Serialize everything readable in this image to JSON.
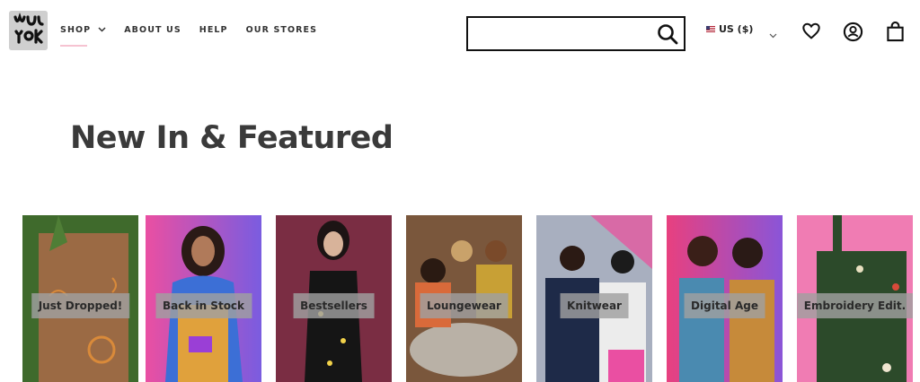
{
  "brand": {
    "logo_text": "Lucy & Yak"
  },
  "nav": {
    "items": [
      {
        "label": "SHOP",
        "has_dropdown": true
      },
      {
        "label": "ABOUT US"
      },
      {
        "label": "HELP"
      },
      {
        "label": "OUR STORES"
      }
    ]
  },
  "search": {
    "value": "",
    "placeholder": ""
  },
  "currency": {
    "label": "US ($)"
  },
  "icons": {
    "search": "search-icon",
    "currency_dropdown": "chevron-down-icon",
    "wishlist": "heart-icon",
    "account": "account-icon",
    "cart": "bag-icon"
  },
  "section": {
    "title": "New In & Featured"
  },
  "categories": [
    {
      "label": "Just Dropped!",
      "bg": "#4a6b2f",
      "accent": "#9a6b45"
    },
    {
      "label": "Back in Stock",
      "bg": "#e2559d",
      "accent": "#7c5bd6"
    },
    {
      "label": "Bestsellers",
      "bg": "#7a2f45",
      "accent": "#1a1a1a"
    },
    {
      "label": "Loungewear",
      "bg": "#7d5a3f",
      "accent": "#c77a3b"
    },
    {
      "label": "Knitwear",
      "bg": "#a9b1c2",
      "accent": "#1e2a48"
    },
    {
      "label": "Digital Age",
      "bg": "#e44b8c",
      "accent": "#5aa0c6"
    },
    {
      "label": "Embroidery Edit.",
      "bg": "#f07cb3",
      "accent": "#2c4a2a"
    }
  ],
  "colors": {
    "accent_underline": "#f6c3d1",
    "text_dark": "#3a3a3a"
  }
}
